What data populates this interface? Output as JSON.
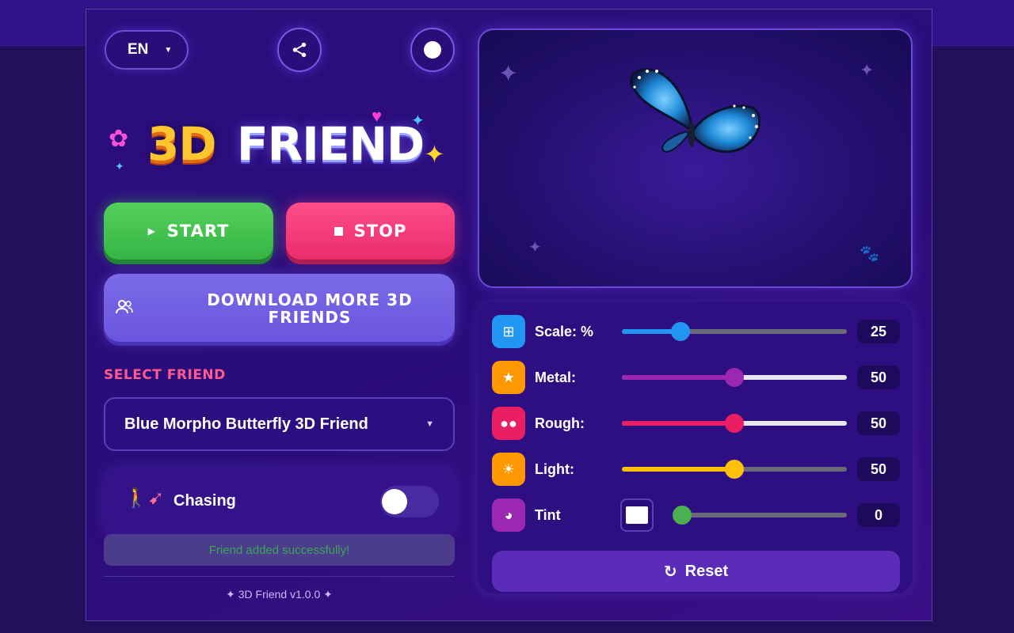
{
  "header": {
    "language": "EN",
    "share_icon": "share-icon",
    "theme_icon": "theme-toggle-icon"
  },
  "logo": {
    "part1": "3D",
    "part2": "FRIEND"
  },
  "actions": {
    "start_label": "START",
    "stop_label": "STOP",
    "download_label": "DOWNLOAD MORE 3D FRIENDS"
  },
  "friend": {
    "section_label": "SELECT FRIEND",
    "selected": "Blue Morpho Butterfly 3D Friend"
  },
  "chasing": {
    "label": "Chasing",
    "enabled": false
  },
  "status": {
    "message": "Friend added successfully!"
  },
  "footer": {
    "version": "✦ 3D Friend v1.0.0 ✦"
  },
  "controls": {
    "scale": {
      "label": "Scale: %",
      "value": "25",
      "fraction": 0.26,
      "color": "#2196f3"
    },
    "metal": {
      "label": "Metal:",
      "value": "50",
      "fraction": 0.5,
      "color": "#9c27b0"
    },
    "rough": {
      "label": "Rough:",
      "value": "50",
      "fraction": 0.5,
      "color": "#e91e63"
    },
    "light": {
      "label": "Light:",
      "value": "50",
      "fraction": 0.5,
      "color": "#ffc107"
    },
    "tint": {
      "label": "Tint",
      "value": "0",
      "fraction": 0.0,
      "color": "#4caf50",
      "swatch_color": "#ffffff"
    },
    "reset_label": "Reset"
  },
  "colors": {
    "start": "#3fc24d",
    "stop": "#f23374",
    "download": "#7261e3",
    "accent_label": "#ff5a90"
  }
}
